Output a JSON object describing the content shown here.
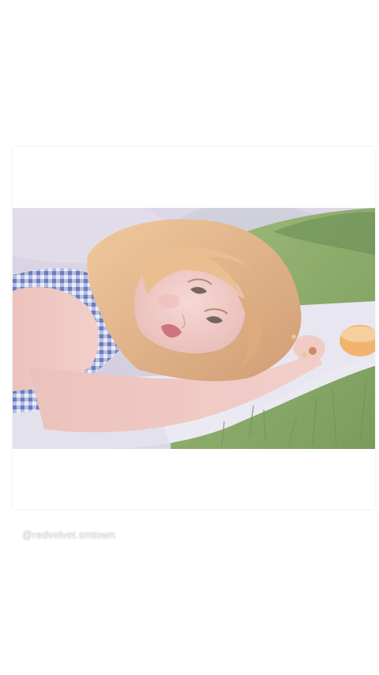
{
  "post": {
    "photo_description_icon": "photo-image",
    "watermark_text": "@redvelvet.smtown"
  },
  "colors": {
    "background": "#ffffff",
    "grass": "#6f9a45",
    "blanket": "#ecebf3",
    "hair": "#e6ad72",
    "gingham": "#5b6fb5"
  }
}
